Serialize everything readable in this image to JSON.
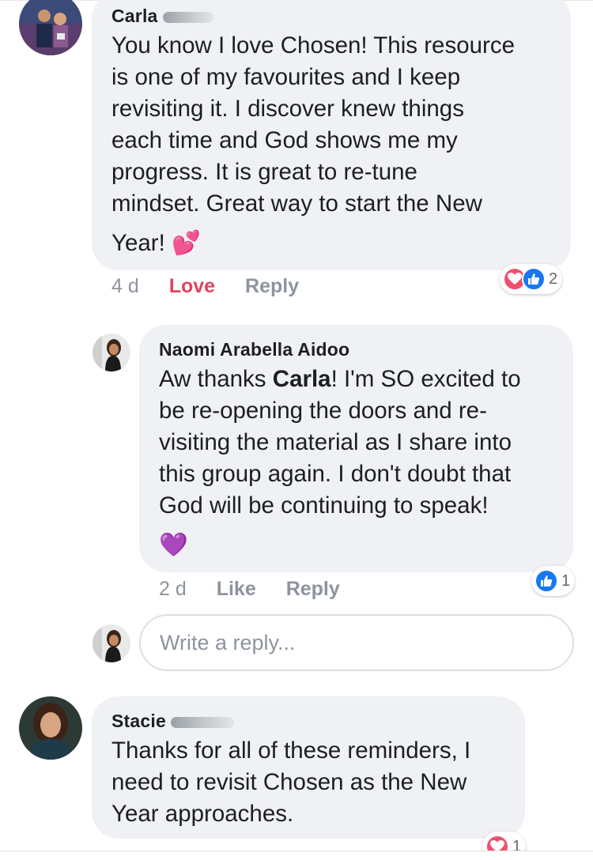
{
  "comments": [
    {
      "author": "Carla",
      "body_lines": [
        "You know I love Chosen! This resource",
        "is one of my favourites and I keep",
        "revisiting it. I discover knew things",
        "each time and God shows me my",
        "progress. It is great to re-tune",
        "mindset. Great way to start the New"
      ],
      "last_line": "Year!",
      "emoji": "💕",
      "time": "4 d",
      "love_label": "Love",
      "reply_label": "Reply",
      "reaction_count": "2"
    },
    {
      "author": "Naomi Arabella Aidoo",
      "body_line1_prefix": "Aw thanks ",
      "body_line1_mention": "Carla",
      "body_line1_suffix": "! I'm SO excited to",
      "body_lines": [
        "be re-opening the doors and re-",
        "visiting the material as I share into",
        "this group again. I don't doubt that",
        "God will be continuing to speak!"
      ],
      "emoji": "💜",
      "time": "2 d",
      "like_label": "Like",
      "reply_label": "Reply",
      "reaction_count": "1"
    },
    {
      "author": "Stacie",
      "body_lines": [
        "Thanks for all of these reminders, I",
        "need to revisit Chosen as the New",
        "Year approaches."
      ],
      "reaction_count": "1"
    }
  ],
  "reply_box": {
    "placeholder": "Write a reply..."
  },
  "colors": {
    "bubble": "#f0f1f4",
    "love": "#e0455d",
    "like": "#1877f2",
    "muted": "#8d949e"
  }
}
